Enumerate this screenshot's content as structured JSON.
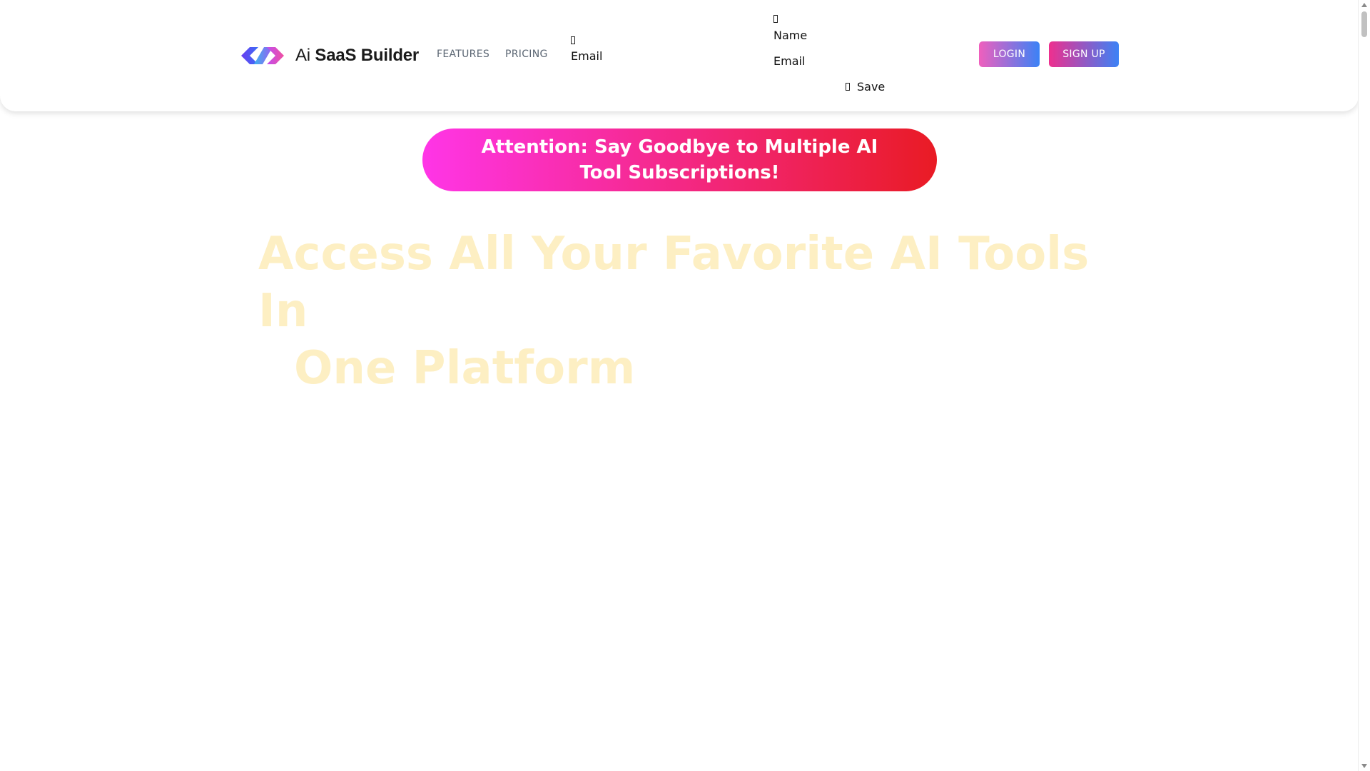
{
  "header": {
    "logo": {
      "icon": "brand-logo-icon",
      "text_light": "Ai",
      "text_bold": "SaaS Builder"
    },
    "nav": {
      "features": "FEATURES",
      "pricing": "PRICING"
    },
    "email_menu": {
      "icon": "missing-glyph-icon",
      "label": "Email"
    },
    "form": {
      "icon": "missing-glyph-icon",
      "name_label": "Name",
      "email_label": "Email",
      "save_icon": "missing-glyph-icon",
      "save_label": "Save"
    },
    "buttons": {
      "login": "LOGIN",
      "signup": "SIGN UP"
    }
  },
  "banner": {
    "text": "Attention: Say Goodbye to Multiple AI Tool Subscriptions!"
  },
  "hero": {
    "line1": "Access All Your Favorite AI Tools In",
    "line2": "One Platform"
  },
  "colors": {
    "banner_gradient_start": "#ff35e7",
    "banner_gradient_end": "#e91b24",
    "hero_text": "#fdefc3",
    "login_gradient": [
      "#ef5fbd",
      "#3b82f6"
    ],
    "signup_gradient": [
      "#ee2f8e",
      "#3b82f6"
    ],
    "nav_text": "#5b6673"
  }
}
